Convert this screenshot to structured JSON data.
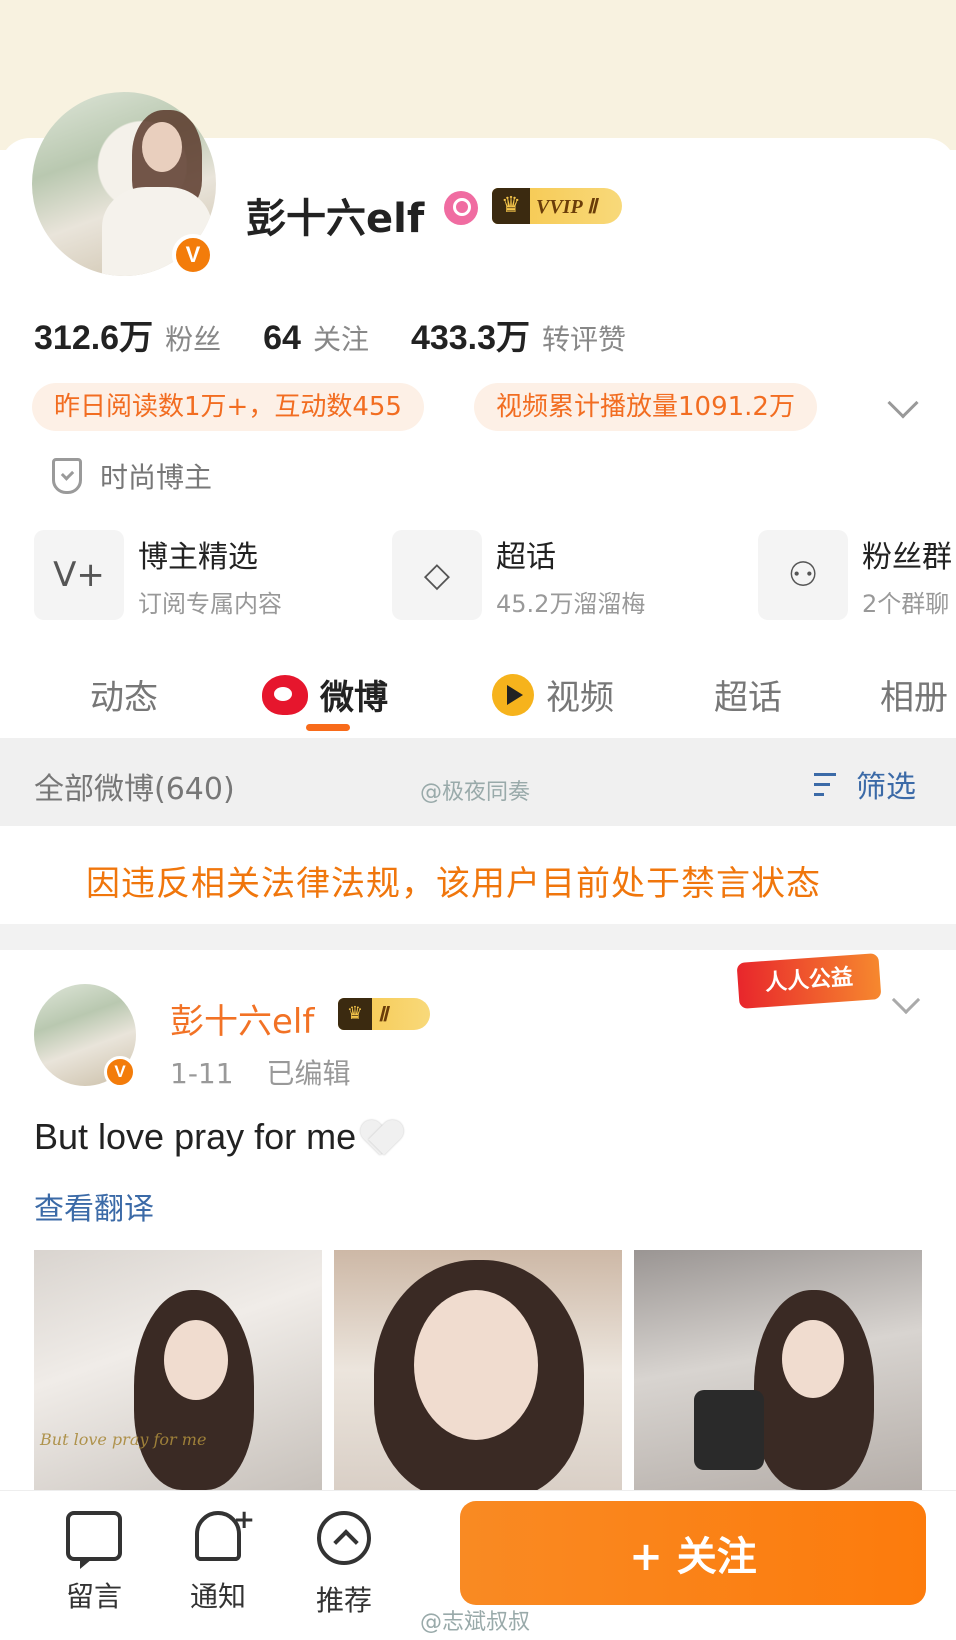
{
  "profile": {
    "name": "彭十六elf",
    "vip_label": "VVIP Ⅱ",
    "verified_badge": "V",
    "stats": [
      {
        "value": "312.6万",
        "label": "粉丝"
      },
      {
        "value": "64",
        "label": "关注"
      },
      {
        "value": "433.3万",
        "label": "转评赞"
      }
    ],
    "pills": [
      "昨日阅读数1万+，互动数455",
      "视频累计播放量1091.2万"
    ],
    "tag": "时尚博主",
    "features": [
      {
        "icon": "v-plus-icon",
        "glyph": "V+",
        "title": "博主精选",
        "subtitle": "订阅专属内容"
      },
      {
        "icon": "diamond-icon",
        "glyph": "◇",
        "title": "超话",
        "subtitle": "45.2万溜溜梅"
      },
      {
        "icon": "group-icon",
        "glyph": "⚇",
        "title": "粉丝群",
        "subtitle": "2个群聊"
      }
    ]
  },
  "tabs": [
    {
      "label": "动态"
    },
    {
      "label": "微博",
      "active": true
    },
    {
      "label": "视频"
    },
    {
      "label": "超话"
    },
    {
      "label": "相册"
    }
  ],
  "filter_bar": {
    "all_label": "全部微博(640)",
    "filter_label": "筛选"
  },
  "watermarks": [
    "@极夜同奏",
    "@志斌叔叔"
  ],
  "notice": "因违反相关法律法规，该用户目前处于禁言状态",
  "post": {
    "author": "彭十六elf",
    "vip_label": "Ⅱ",
    "date": "1-11",
    "edited": "已编辑",
    "charity_badge": "人人公益",
    "text": "But love pray for me",
    "emoji": "white-heart-icon",
    "translate_link": "查看翻译",
    "photo_caption": "But love pray for me"
  },
  "bottom_bar": {
    "items": [
      {
        "icon": "message-icon",
        "label": "留言"
      },
      {
        "icon": "bell-icon",
        "label": "通知"
      },
      {
        "icon": "recommend-icon",
        "label": "推荐"
      }
    ],
    "follow_label": "+ 关注"
  },
  "colors": {
    "accent_orange": "#f86b1a",
    "link_blue": "#3b6aa7",
    "banner_cream": "#f8f2e0",
    "notice_orange": "#f0760c"
  }
}
